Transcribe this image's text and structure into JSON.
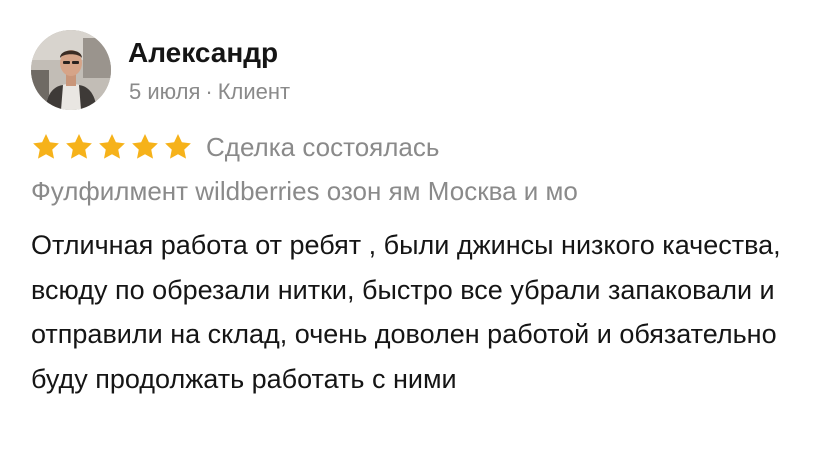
{
  "review": {
    "author": "Александр",
    "date": "5 июля",
    "separator": "·",
    "role": "Клиент",
    "rating": 5,
    "rating_max": 5,
    "deal_status": "Сделка состоялась",
    "service": "Фулфилмент wildberries озон ям Москва и мо",
    "text": "Отличная работа от ребят , были джинсы низкого качества, всюду по обрезали нитки, быстро все убрали запаковали и отправили на склад, очень доволен работой и обязательно буду продолжать работать с ними"
  },
  "colors": {
    "star": "#f6b21a",
    "muted_text": "#8a8a8a",
    "main_text": "#151515"
  },
  "icons": {
    "avatar": "user-photo",
    "star": "star-icon"
  }
}
